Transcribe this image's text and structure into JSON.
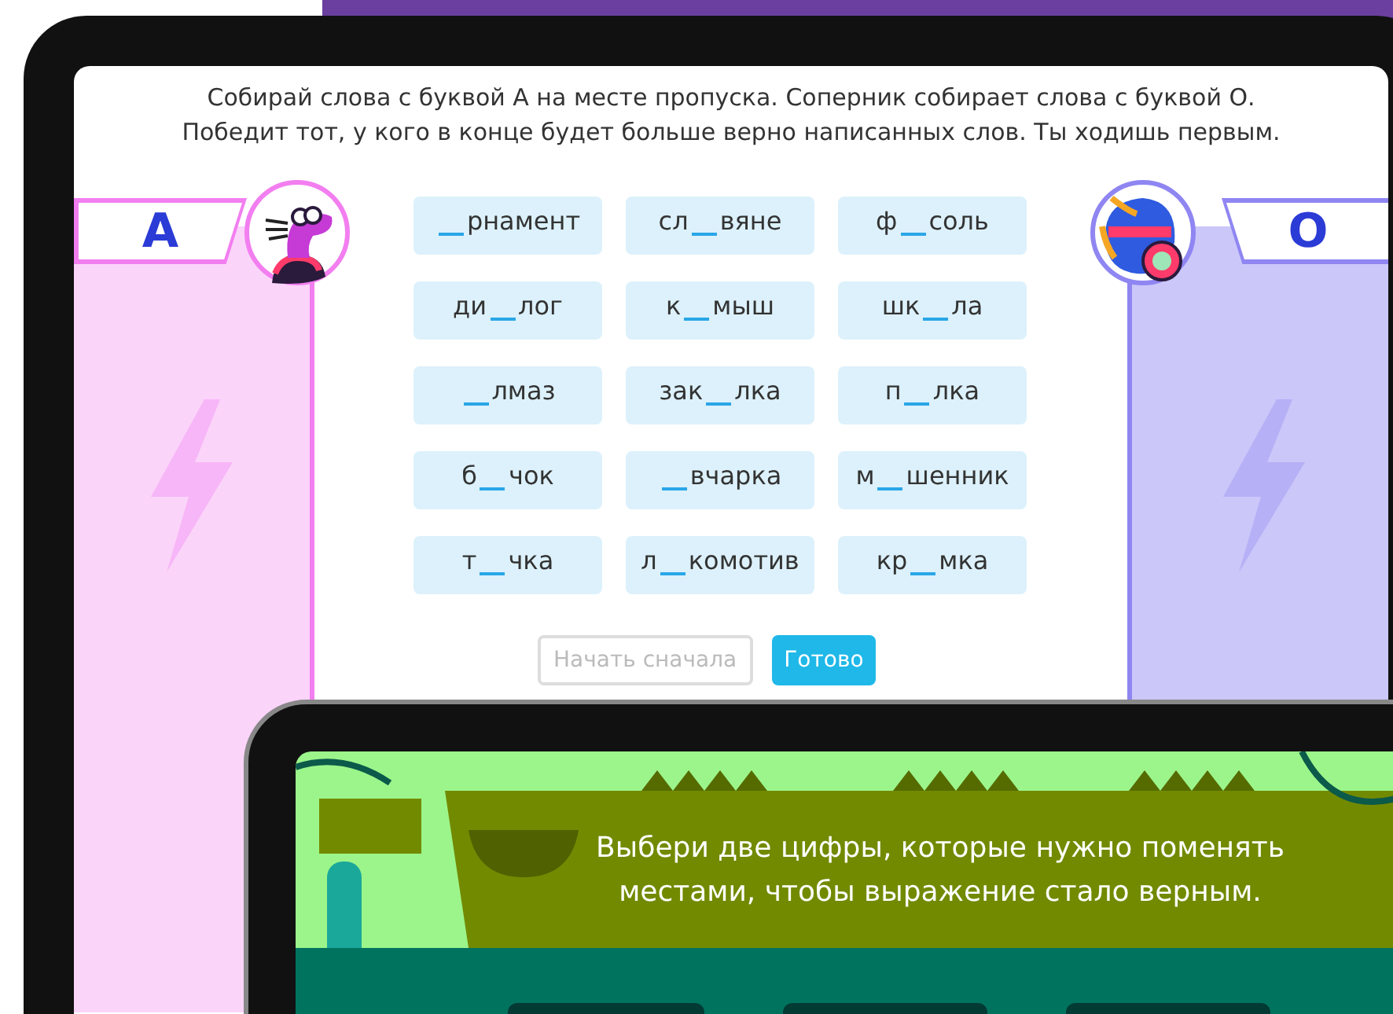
{
  "back_tablet": {
    "instruction": "Собирай слова с буквой А на месте пропуска. Соперник собирает слова с буквой О. Победит тот, у кого в конце будет больше верно написанных слов. Ты ходишь первым.",
    "players": [
      {
        "letter": "А",
        "color": "#f27ef0"
      },
      {
        "letter": "О",
        "color": "#8f86f2"
      }
    ],
    "words": [
      {
        "after": "рнамент"
      },
      {
        "before": "сл",
        "after": "вяне"
      },
      {
        "before": "ф",
        "after": "соль"
      },
      {
        "before": "ди",
        "after": "лог"
      },
      {
        "before": "к",
        "after": "мыш"
      },
      {
        "before": "шк",
        "after": "ла"
      },
      {
        "after": "лмаз"
      },
      {
        "before": "зак",
        "after": "лка"
      },
      {
        "before": "п",
        "after": "лка"
      },
      {
        "before": "б",
        "after": "чок"
      },
      {
        "after": "вчарка"
      },
      {
        "before": "м",
        "after": "шенник"
      },
      {
        "before": "т",
        "after": "чка"
      },
      {
        "before": "л",
        "after": "комотив"
      },
      {
        "before": "кр",
        "after": "мка"
      }
    ],
    "buttons": [
      {
        "label": "Начать сначала",
        "disabled": true
      },
      {
        "label": "Готово",
        "disabled": false
      }
    ]
  },
  "front_tablet": {
    "task": "Выбери две цифры, которые нужно поменять местами, чтобы выражение стало верным."
  }
}
